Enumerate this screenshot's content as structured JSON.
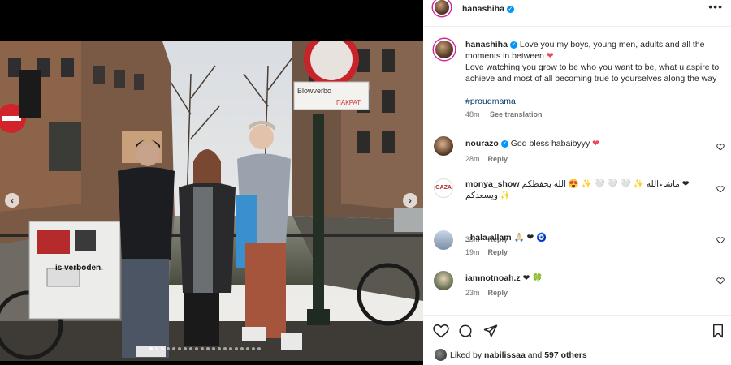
{
  "post": {
    "username": "hanashiha",
    "caption_line1": "Love you my boys, young men, adults and all the moments in between",
    "caption_line2": "Love watching you grow to be who you want to be, what u aspire to achieve and most of all becoming true to yourselves along the way ..",
    "hashtag": "#proudmama",
    "time": "48m",
    "see_translation": "See translation"
  },
  "comments": [
    {
      "username": "nourazo",
      "text": "God bless habaibyyy",
      "emoji": "❤",
      "time": "28m",
      "reply": "Reply"
    },
    {
      "username": "monya_show",
      "text": "ماشاءالله ✨ 🤍 🤍 🤍 ✨ 😍 الله يحفظكم ❤",
      "text2": "ويسعدكم ✨",
      "time": "38m",
      "reply": "Reply"
    },
    {
      "username": "_hala.allam",
      "text": "🙏🏻 ❤ 🧿",
      "time": "19m",
      "reply": "Reply"
    },
    {
      "username": "iamnotnoah.z",
      "text": "❤ 🍀",
      "time": "23m",
      "reply": "Reply"
    }
  ],
  "likes": {
    "prefix": "Liked by",
    "user": "nabilissaa",
    "connector": "and",
    "count": "597 others"
  },
  "photo_signs": {
    "sign1": "is verboden.",
    "sign2": "Blowverbo",
    "sign3": "ПАКРАТ"
  },
  "carousel": {
    "count": 20,
    "active": 0
  },
  "colors": {
    "accent": "#0095f6",
    "heart": "#ed4956",
    "link": "#00376b",
    "meta": "#737373"
  }
}
